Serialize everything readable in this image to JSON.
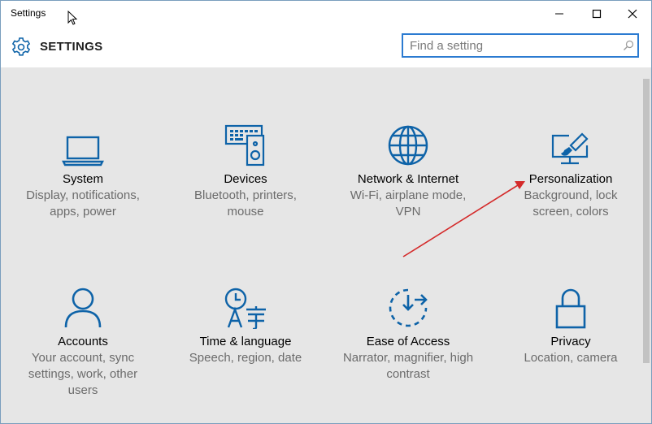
{
  "window": {
    "title": "Settings"
  },
  "header": {
    "heading": "SETTINGS"
  },
  "search": {
    "placeholder": "Find a setting"
  },
  "accent": "#0e63a8",
  "tiles": [
    {
      "title": "System",
      "desc": "Display, notifications, apps, power",
      "icon": "laptop-icon"
    },
    {
      "title": "Devices",
      "desc": "Bluetooth, printers, mouse",
      "icon": "devices-icon"
    },
    {
      "title": "Network & Internet",
      "desc": "Wi-Fi, airplane mode, VPN",
      "icon": "globe-icon"
    },
    {
      "title": "Personalization",
      "desc": "Background, lock screen, colors",
      "icon": "paintbrush-icon"
    },
    {
      "title": "Accounts",
      "desc": "Your account, sync settings, work, other users",
      "icon": "person-icon"
    },
    {
      "title": "Time & language",
      "desc": "Speech, region, date",
      "icon": "time-language-icon"
    },
    {
      "title": "Ease of Access",
      "desc": "Narrator, magnifier, high contrast",
      "icon": "ease-of-access-icon"
    },
    {
      "title": "Privacy",
      "desc": "Location, camera",
      "icon": "lock-icon"
    }
  ]
}
